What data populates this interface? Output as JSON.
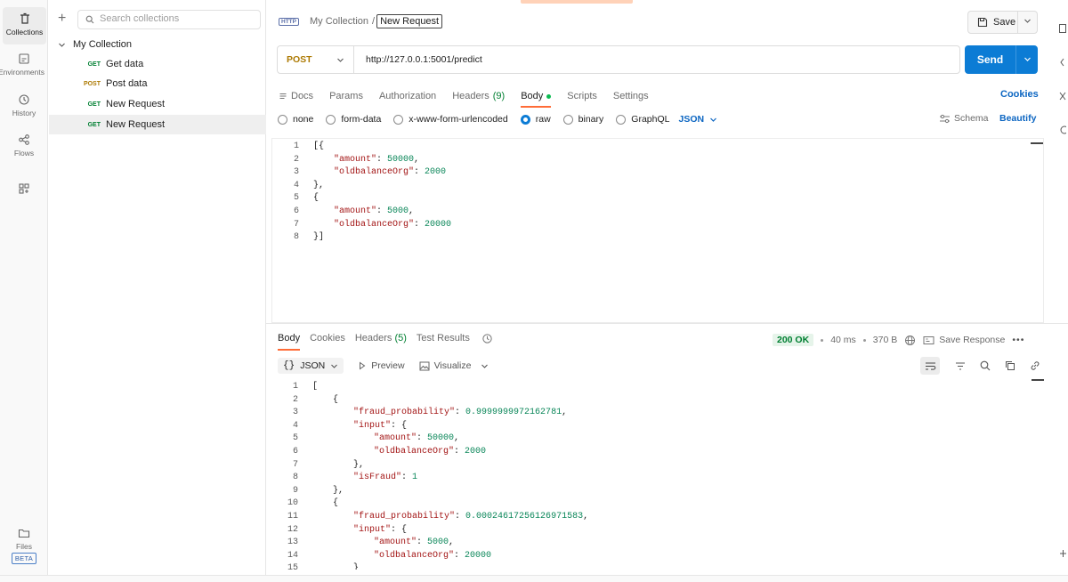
{
  "rail": {
    "items": [
      {
        "label": "Collections",
        "icon": "trash-can-icon"
      },
      {
        "label": "Environments",
        "icon": "environment-icon"
      },
      {
        "label": "History",
        "icon": "history-icon"
      },
      {
        "label": "Flows",
        "icon": "flows-icon"
      },
      {
        "label": "",
        "icon": "add-workspace-icon"
      }
    ],
    "files": {
      "label": "Files",
      "badge": "BETA"
    }
  },
  "sidebar": {
    "search_placeholder": "Search collections",
    "collection_name": "My Collection",
    "requests": [
      {
        "method": "GET",
        "name": "Get data"
      },
      {
        "method": "POST",
        "name": "Post data"
      },
      {
        "method": "GET",
        "name": "New Request"
      },
      {
        "method": "GET",
        "name": "New Request"
      }
    ]
  },
  "header": {
    "http_badge": "HTTP",
    "breadcrumb_parent": "My Collection",
    "breadcrumb_sep": "/",
    "breadcrumb_current": "New Request",
    "save_label": "Save"
  },
  "request": {
    "method": "POST",
    "url": "http://127.0.0.1:5001/predict",
    "send_label": "Send",
    "tabs": [
      {
        "label": "Docs"
      },
      {
        "label": "Params"
      },
      {
        "label": "Authorization"
      },
      {
        "label": "Headers",
        "count": "(9)"
      },
      {
        "label": "Body"
      },
      {
        "label": "Scripts"
      },
      {
        "label": "Settings"
      }
    ],
    "cookies_label": "Cookies",
    "body_types": [
      "none",
      "form-data",
      "x-www-form-urlencoded",
      "raw",
      "binary",
      "GraphQL"
    ],
    "selected_body_type": "raw",
    "language": "JSON",
    "schema_label": "Schema",
    "beautify_label": "Beautify",
    "body_lines": [
      {
        "n": "1",
        "text": "[{"
      },
      {
        "n": "2",
        "indent": 1,
        "key": "\"amount\"",
        "value": "50000",
        "trail": ","
      },
      {
        "n": "3",
        "indent": 1,
        "key": "\"oldbalanceOrg\"",
        "value": "2000",
        "trail": ""
      },
      {
        "n": "4",
        "text": "},"
      },
      {
        "n": "5",
        "text": "{"
      },
      {
        "n": "6",
        "indent": 1,
        "key": "\"amount\"",
        "value": "5000",
        "trail": ","
      },
      {
        "n": "7",
        "indent": 1,
        "key": "\"oldbalanceOrg\"",
        "value": "20000",
        "trail": ""
      },
      {
        "n": "8",
        "text": "}]"
      }
    ]
  },
  "response": {
    "tabs": [
      {
        "label": "Body"
      },
      {
        "label": "Cookies"
      },
      {
        "label": "Headers",
        "count": "(5)"
      },
      {
        "label": "Test Results"
      }
    ],
    "status": "200 OK",
    "time": "40 ms",
    "size": "370 B",
    "save_response_label": "Save Response",
    "format": "JSON",
    "format_brace": "{}",
    "preview_label": "Preview",
    "visualize_label": "Visualize",
    "lines": [
      {
        "n": "1",
        "indent": 0,
        "text": "["
      },
      {
        "n": "2",
        "indent": 1,
        "text": "{"
      },
      {
        "n": "3",
        "indent": 2,
        "key": "\"fraud_probability\"",
        "value": "0.9999999972162781",
        "trail": ","
      },
      {
        "n": "4",
        "indent": 2,
        "key": "\"input\"",
        "text": "{"
      },
      {
        "n": "5",
        "indent": 3,
        "key": "\"amount\"",
        "value": "50000",
        "trail": ","
      },
      {
        "n": "6",
        "indent": 3,
        "key": "\"oldbalanceOrg\"",
        "value": "2000",
        "trail": ""
      },
      {
        "n": "7",
        "indent": 2,
        "text": "},"
      },
      {
        "n": "8",
        "indent": 2,
        "key": "\"isFraud\"",
        "value": "1",
        "trail": ""
      },
      {
        "n": "9",
        "indent": 1,
        "text": "},"
      },
      {
        "n": "10",
        "indent": 1,
        "text": "{"
      },
      {
        "n": "11",
        "indent": 2,
        "key": "\"fraud_probability\"",
        "value": "0.00024617256126971583",
        "trail": ","
      },
      {
        "n": "12",
        "indent": 2,
        "key": "\"input\"",
        "text": "{"
      },
      {
        "n": "13",
        "indent": 3,
        "key": "\"amount\"",
        "value": "5000",
        "trail": ","
      },
      {
        "n": "14",
        "indent": 3,
        "key": "\"oldbalanceOrg\"",
        "value": "20000",
        "trail": ""
      },
      {
        "n": "15",
        "indent": 2,
        "text": "}"
      }
    ]
  },
  "colors": {
    "accent": "#ff6c37",
    "send": "#0c7cd5",
    "get": "#007f31",
    "post": "#ad7a03",
    "json_key": "#a31515",
    "json_number": "#098658"
  }
}
